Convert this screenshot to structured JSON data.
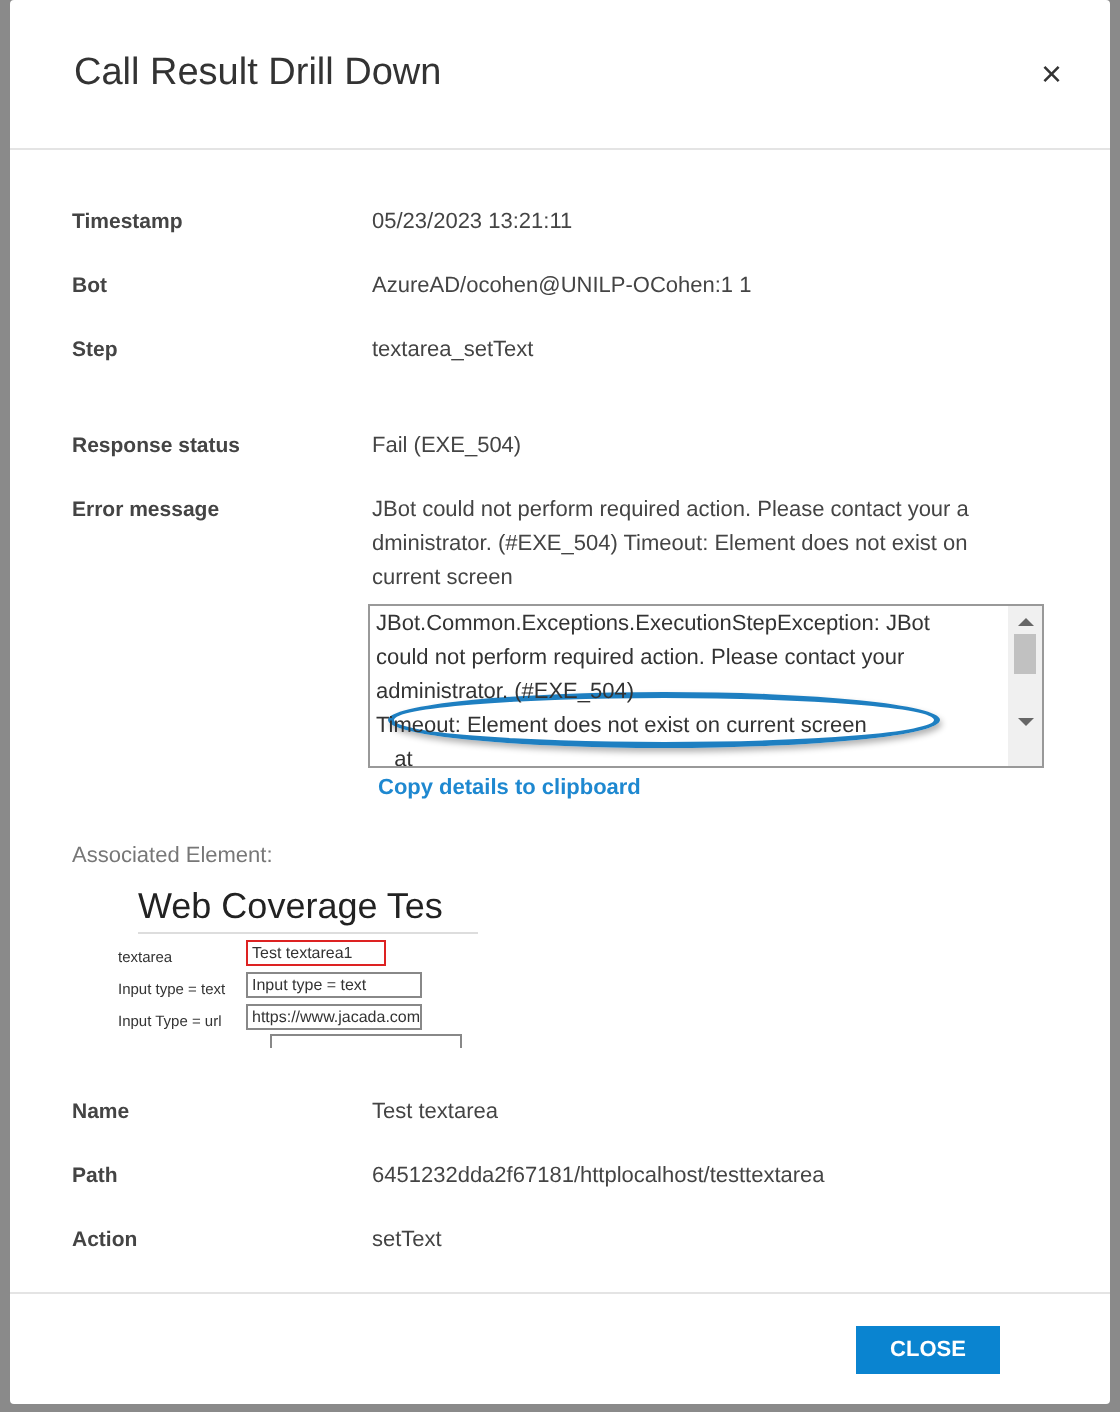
{
  "dialog": {
    "title": "Call Result Drill Down",
    "close_icon": "×"
  },
  "groups": [
    {
      "fields": [
        {
          "label": "Timestamp",
          "value": "05/23/2023 13:21:11"
        },
        {
          "label": "Bot",
          "value": "AzureAD/ocohen@UNILP-OCohen:1 1"
        },
        {
          "label": "Step",
          "value": "textarea_setText"
        }
      ]
    },
    {
      "fields": [
        {
          "label": "Response status",
          "value": "Fail (EXE_504)"
        }
      ]
    }
  ],
  "error": {
    "label": "Error message",
    "message_lines": [
      "JBot could not perform required action. Please contact your a",
      "dministrator. (#EXE_504) Timeout: Element does not exist on",
      "current screen"
    ],
    "details_lines": [
      "JBot.Common.Exceptions.ExecutionStepException: JBot",
      "could not perform required action. Please contact your",
      "administrator. (#EXE_504)",
      "Timeout: Element does not exist on current screen",
      "   at"
    ],
    "copy_link": "Copy details to clipboard"
  },
  "associated_element": {
    "label": "Associated Element:",
    "snapshot": {
      "heading": "Web Coverage Tes",
      "rows": [
        {
          "label": "textarea",
          "value": "Test textarea1",
          "highlighted": true
        },
        {
          "label": "Input type = text",
          "value": "Input type = text",
          "highlighted": false
        },
        {
          "label": "Input Type = url",
          "value": "https://www.jacada.com",
          "highlighted": false
        }
      ]
    }
  },
  "element_fields": [
    {
      "label": "Name",
      "value": "Test textarea"
    },
    {
      "label": "Path",
      "value": "6451232dda2f67181/httplocalhost/testtextarea"
    },
    {
      "label": "Action",
      "value": "setText"
    }
  ],
  "footer": {
    "button": "CLOSE"
  }
}
